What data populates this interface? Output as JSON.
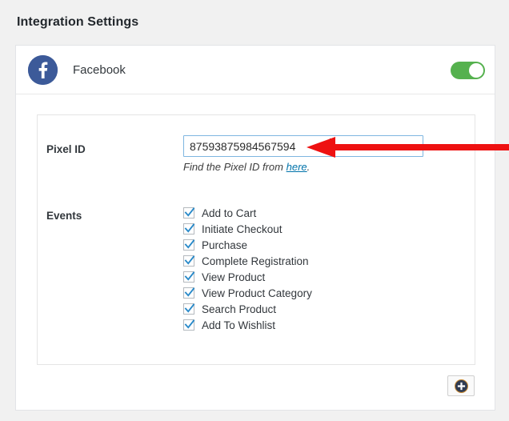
{
  "page": {
    "title": "Integration Settings"
  },
  "card": {
    "brand": {
      "name": "Facebook",
      "icon": "facebook-f-icon",
      "badge_color": "#3c5a99"
    },
    "toggle": {
      "state": "on",
      "color": "#55b14e"
    }
  },
  "form": {
    "pixel": {
      "label": "Pixel ID",
      "value": "87593875984567594",
      "placeholder": "Pixel ID",
      "focus_border_color": "#7eb6e0"
    },
    "help": {
      "prefix": "Find the Pixel ID from ",
      "link_text": "here",
      "suffix": ".",
      "link_color": "#0073aa"
    },
    "events": {
      "label": "Events",
      "items": [
        {
          "label": "Add to Cart",
          "checked": true
        },
        {
          "label": "Initiate Checkout",
          "checked": true
        },
        {
          "label": "Purchase",
          "checked": true
        },
        {
          "label": "Complete Registration",
          "checked": true
        },
        {
          "label": "View Product",
          "checked": true
        },
        {
          "label": "View Product Category",
          "checked": true
        },
        {
          "label": "Search Product",
          "checked": true
        },
        {
          "label": "Add To Wishlist",
          "checked": true
        }
      ],
      "check_color": "#2a8ac9"
    }
  },
  "actions": {
    "add": {
      "icon": "plus-circle-icon",
      "label": ""
    }
  },
  "annotation": {
    "arrow": {
      "color": "#ee1111",
      "direction": "left",
      "points_at": "pixel-id-input"
    }
  }
}
